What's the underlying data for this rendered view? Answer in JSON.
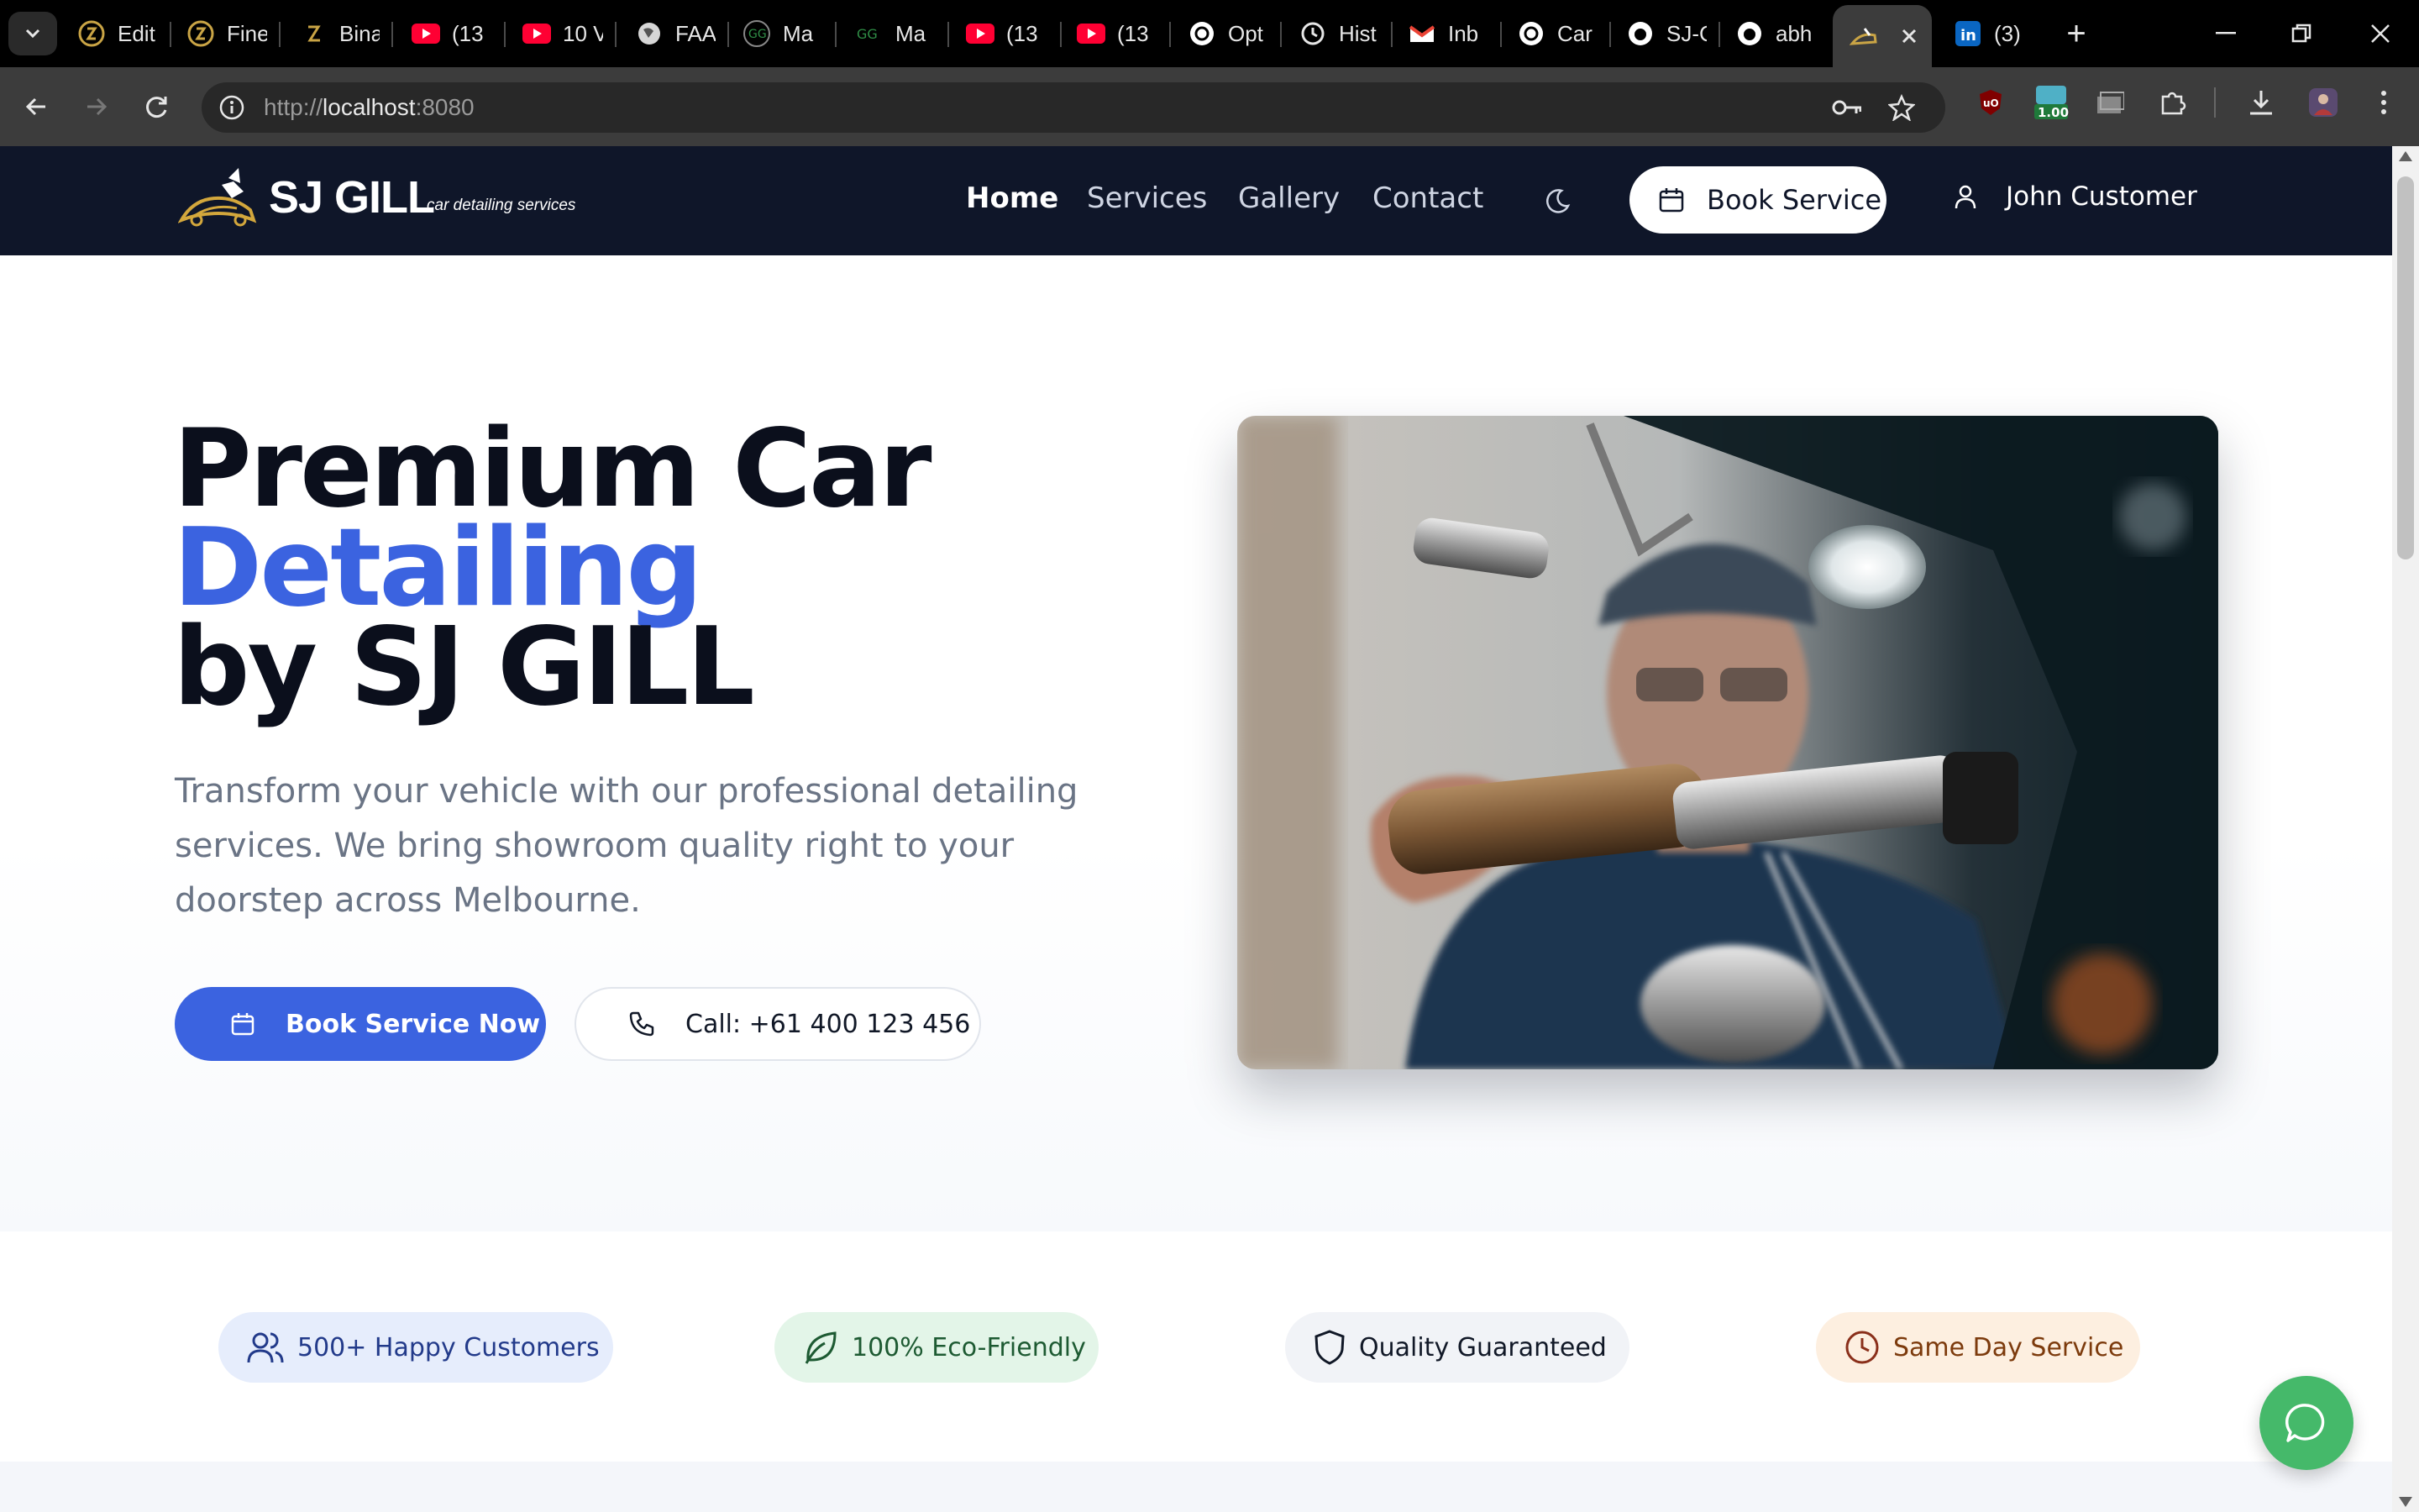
{
  "browser": {
    "tabs": [
      {
        "title": "Edit",
        "icon": "edit-app-icon"
      },
      {
        "title": "Fine",
        "icon": "app-icon"
      },
      {
        "title": "Bina",
        "icon": "app-icon"
      },
      {
        "title": "(13",
        "icon": "youtube-icon"
      },
      {
        "title": "10 V",
        "icon": "youtube-icon"
      },
      {
        "title": "FAA",
        "icon": "globe-icon"
      },
      {
        "title": "Ma",
        "icon": "geeks-icon"
      },
      {
        "title": "Ma",
        "icon": "geeks-icon"
      },
      {
        "title": "(13",
        "icon": "youtube-icon"
      },
      {
        "title": "(13",
        "icon": "youtube-icon"
      },
      {
        "title": "Opt",
        "icon": "openai-icon"
      },
      {
        "title": "Hist",
        "icon": "history-icon"
      },
      {
        "title": "Inb",
        "icon": "gmail-icon"
      },
      {
        "title": "Car",
        "icon": "openai-icon"
      },
      {
        "title": "SJ-C",
        "icon": "github-icon"
      },
      {
        "title": "abh",
        "icon": "github-icon"
      },
      {
        "title": "",
        "icon": "sj-gill-logo-icon",
        "active": true
      },
      {
        "title": "(3)",
        "icon": "linkedin-icon"
      }
    ],
    "url_scheme": "http://",
    "url_host": "localhost",
    "url_port": ":8080",
    "extension_badge": "1.00"
  },
  "site": {
    "brand": "SJ GILL",
    "tagline": "car detailing services",
    "nav": {
      "home": "Home",
      "services": "Services",
      "gallery": "Gallery",
      "contact": "Contact"
    },
    "book_button": "Book Service",
    "user_name": "John Customer"
  },
  "hero": {
    "title_line1": "Premium Car",
    "title_line2": "Detailing",
    "title_line3": "by SJ GILL",
    "subtitle": "Transform your vehicle with our professional detailing services. We bring showroom quality right to your doorstep across Melbourne.",
    "primary_cta": "Book Service Now",
    "call_cta": "Call: +61 400 123 456"
  },
  "badges": [
    {
      "label": "500+ Happy Customers",
      "icon": "users-icon"
    },
    {
      "label": "100% Eco-Friendly",
      "icon": "leaf-icon"
    },
    {
      "label": "Quality Guaranteed",
      "icon": "shield-icon"
    },
    {
      "label": "Same Day Service",
      "icon": "clock-icon"
    }
  ],
  "colors": {
    "header_bg": "#0f1629",
    "accent": "#3b63e0",
    "chat_fab": "#45b96a"
  }
}
